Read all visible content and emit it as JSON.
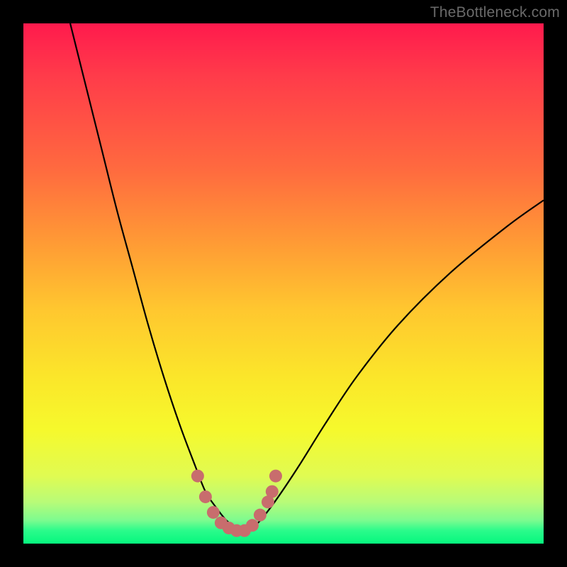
{
  "watermark": "TheBottleneck.com",
  "chart_data": {
    "type": "line",
    "title": "",
    "xlabel": "",
    "ylabel": "",
    "xlim": [
      0,
      100
    ],
    "ylim": [
      0,
      100
    ],
    "series": [
      {
        "name": "bottleneck-curve",
        "x": [
          9,
          12,
          15,
          18,
          21,
          24,
          27,
          30,
          33,
          35,
          37,
          39,
          41,
          42.5,
          44,
          46,
          49,
          53,
          58,
          64,
          72,
          82,
          93,
          100
        ],
        "y": [
          100,
          88,
          76,
          64,
          53,
          42,
          32,
          23,
          15,
          10,
          7,
          4.5,
          3,
          2.5,
          3,
          5,
          9,
          15,
          23,
          32,
          42,
          52,
          61,
          66
        ]
      }
    ],
    "highlight": {
      "name": "valley-dots",
      "points": [
        {
          "x": 33.5,
          "y": 13
        },
        {
          "x": 35,
          "y": 9
        },
        {
          "x": 36.5,
          "y": 6
        },
        {
          "x": 38,
          "y": 4
        },
        {
          "x": 39.5,
          "y": 3
        },
        {
          "x": 41,
          "y": 2.5
        },
        {
          "x": 42.5,
          "y": 2.5
        },
        {
          "x": 44,
          "y": 3.5
        },
        {
          "x": 45.5,
          "y": 5.5
        },
        {
          "x": 47,
          "y": 8
        },
        {
          "x": 47.8,
          "y": 10
        },
        {
          "x": 48.5,
          "y": 13
        }
      ],
      "color": "#c86d6d"
    }
  }
}
